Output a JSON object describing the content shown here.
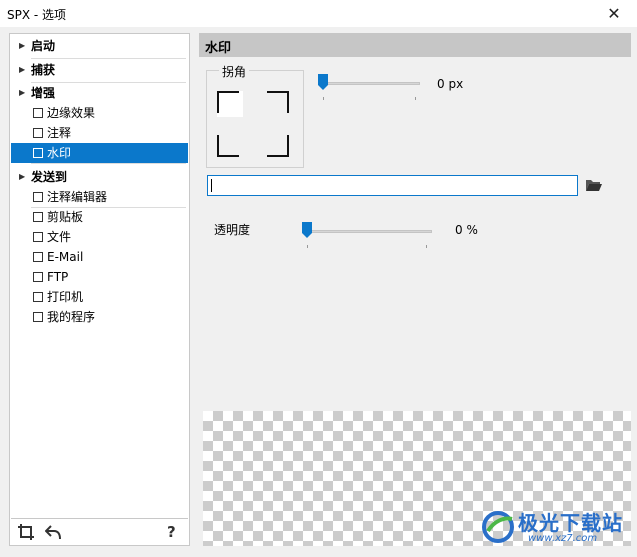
{
  "window": {
    "title": "SPX - 选项",
    "close_glyph": "✕"
  },
  "sidebar": {
    "groups": [
      {
        "label": "启动"
      },
      {
        "label": "捕获"
      },
      {
        "label": "增强",
        "items": [
          "边缘效果",
          "注释",
          "水印"
        ]
      },
      {
        "label": "发送到",
        "items": [
          "注释编辑器",
          "剪贴板",
          "文件",
          "E-Mail",
          "FTP",
          "打印机",
          "我的程序"
        ]
      }
    ],
    "selected": "水印",
    "bottom": {
      "help_label": "?"
    }
  },
  "panel": {
    "title": "水印",
    "corner": {
      "legend": "拐角",
      "selected": "top-left"
    },
    "offset": {
      "value_text": "0 px",
      "value": 0
    },
    "text_value": "",
    "opacity": {
      "label": "透明度",
      "value_text": "0 %",
      "value": 0
    }
  },
  "watermark": {
    "name": "极光下载站",
    "url": "www.xz7.com"
  },
  "colors": {
    "accent": "#0b78cb",
    "header": "#c6c6c6",
    "background": "#f0f0f0"
  },
  "icons": {
    "crop": "crop-icon",
    "undo": "undo-arrow-icon",
    "folder": "folder-open-icon",
    "arrow": "triangle-right-icon"
  }
}
